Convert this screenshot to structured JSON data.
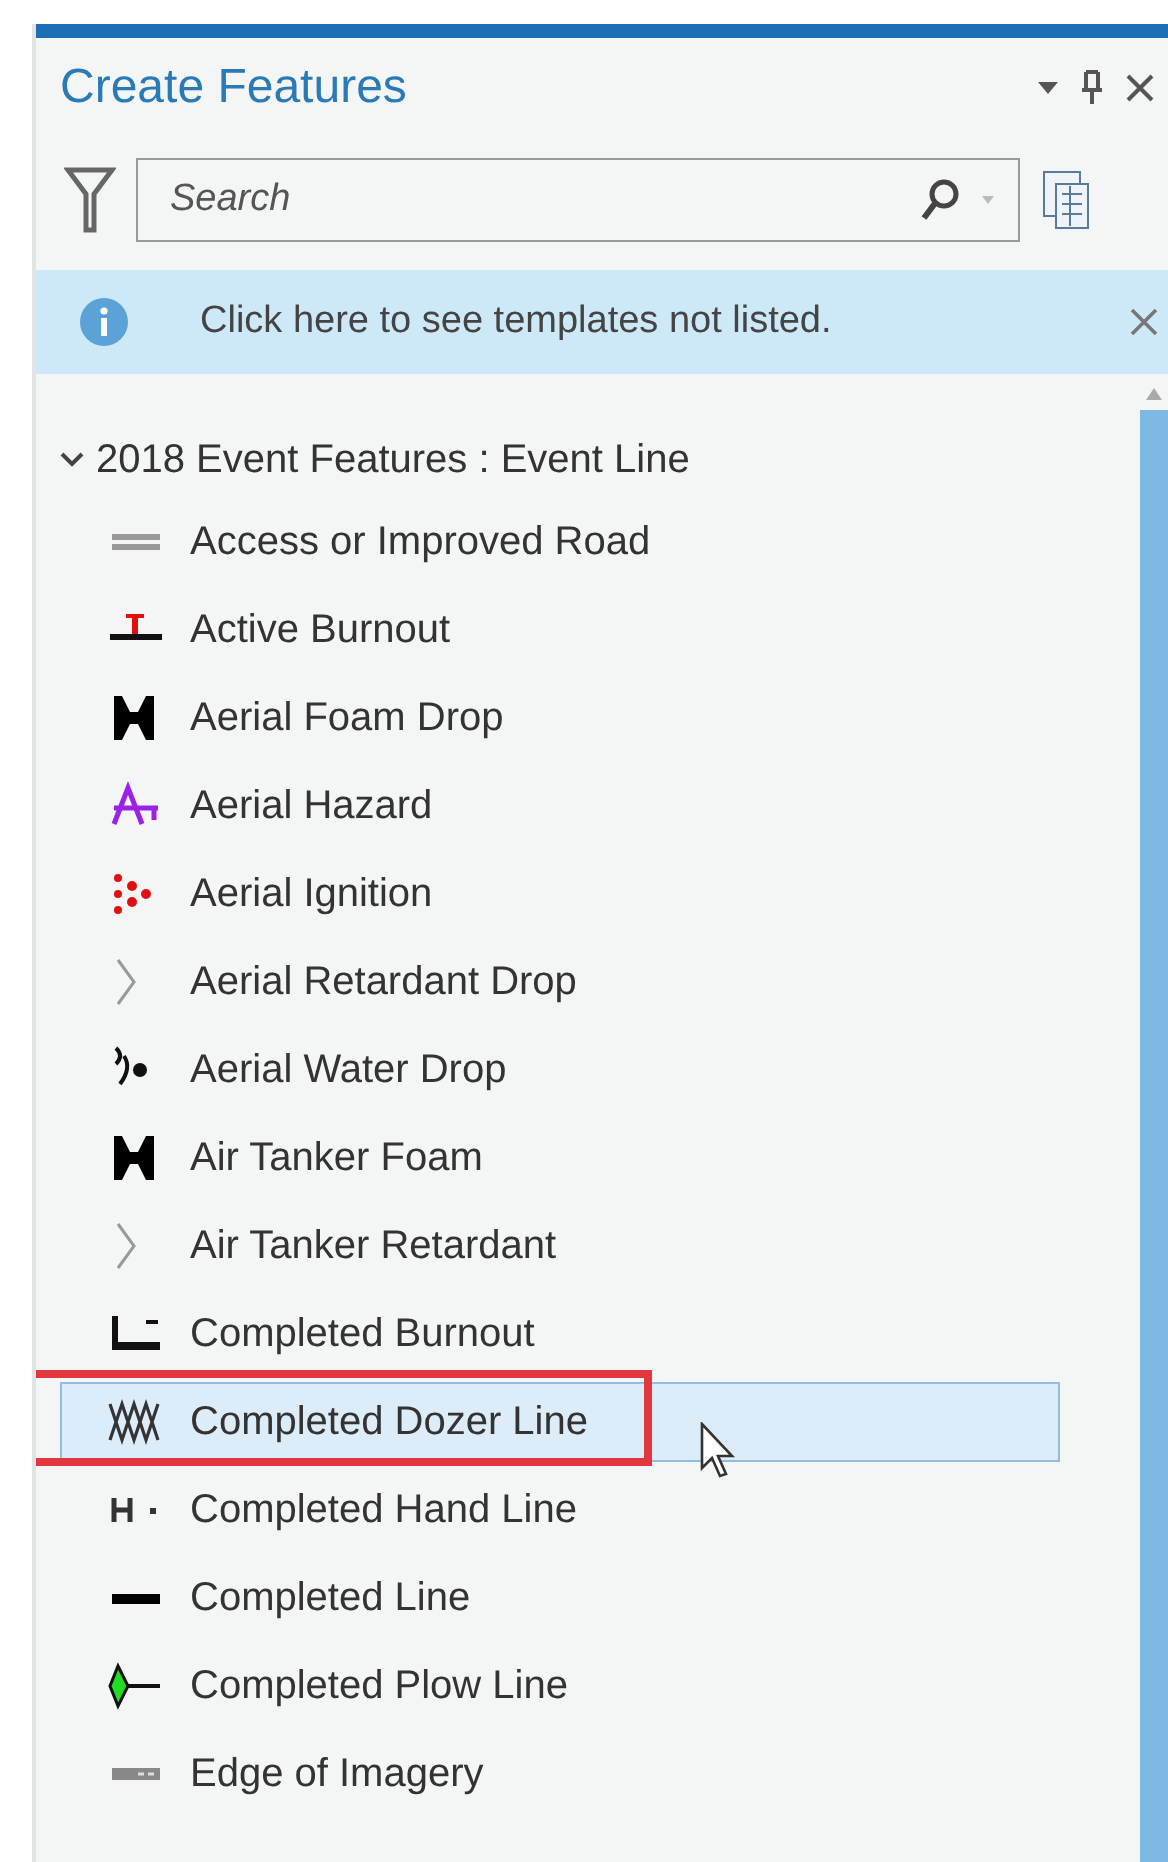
{
  "panel": {
    "title": "Create Features"
  },
  "search": {
    "placeholder": "Search"
  },
  "info_bar": {
    "message": "Click here to see templates not listed."
  },
  "group": {
    "label": "2018 Event Features : Event Line",
    "expanded": true,
    "items": [
      {
        "label": "Access or Improved Road",
        "kind": "double-line",
        "selected": false
      },
      {
        "label": "Active Burnout",
        "kind": "burnout-active",
        "selected": false
      },
      {
        "label": "Aerial Foam Drop",
        "kind": "bowtie",
        "selected": false
      },
      {
        "label": "Aerial Hazard",
        "kind": "hazard",
        "selected": false
      },
      {
        "label": "Aerial Ignition",
        "kind": "ignition",
        "selected": false
      },
      {
        "label": "Aerial Retardant Drop",
        "kind": "chevron",
        "selected": false
      },
      {
        "label": "Aerial Water Drop",
        "kind": "water",
        "selected": false
      },
      {
        "label": "Air Tanker Foam",
        "kind": "bowtie",
        "selected": false
      },
      {
        "label": "Air Tanker Retardant",
        "kind": "chevron",
        "selected": false
      },
      {
        "label": "Completed Burnout",
        "kind": "burnout-completed",
        "selected": false
      },
      {
        "label": "Completed Dozer Line",
        "kind": "dozer",
        "selected": true
      },
      {
        "label": "Completed Hand Line",
        "kind": "hand",
        "selected": false
      },
      {
        "label": "Completed Line",
        "kind": "solid",
        "selected": false
      },
      {
        "label": "Completed Plow Line",
        "kind": "plow",
        "selected": false
      },
      {
        "label": "Edge of Imagery",
        "kind": "dashed",
        "selected": false
      }
    ]
  }
}
